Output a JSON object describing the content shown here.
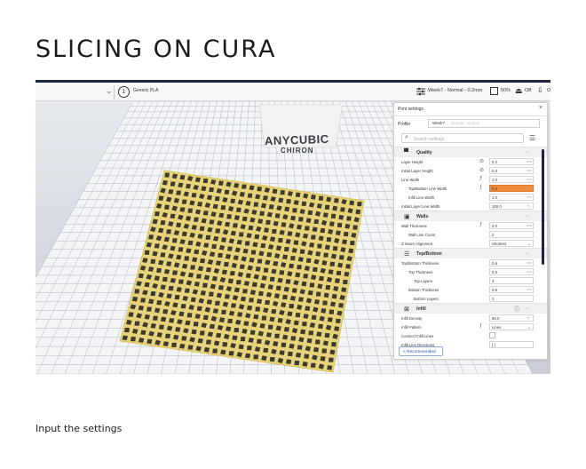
{
  "slide": {
    "title": "SLICING ON CURA",
    "caption": "Input the settings"
  },
  "toolbar": {
    "material_badge": "1",
    "material": "Generic PLA",
    "profile": "Week7 - Normal - 0.2mm",
    "support_value": "50%",
    "adhesion_value": "Off",
    "extra_value": "Of"
  },
  "viewport": {
    "printer_brand": "ANYCUBIC",
    "printer_model": "CHIRON"
  },
  "panel": {
    "title": "Print settings",
    "close_icon": "×",
    "profile_label": "Profile",
    "profile_value": "Week7",
    "profile_hint": "Normal - 0.2mm",
    "search_placeholder": "Search settings",
    "recommended_label": "< Recommended",
    "categories": {
      "quality": "Quality",
      "walls": "Walls",
      "top_bottom": "Top/Bottom",
      "infill": "Infill"
    },
    "settings": {
      "layer_height": {
        "label": "Layer Height",
        "value": "0.2",
        "unit": "mm"
      },
      "initial_layer_height": {
        "label": "Initial Layer Height",
        "value": "0.3",
        "unit": "mm"
      },
      "line_width": {
        "label": "Line Width",
        "value": "1.0",
        "unit": "mm"
      },
      "top_bottom_line_width": {
        "label": "Top/Bottom Line Width",
        "value": "0.4",
        "unit": "mm"
      },
      "infill_line_width": {
        "label": "Infill Line Width",
        "value": "1.0",
        "unit": "mm"
      },
      "initial_layer_line_width": {
        "label": "Initial Layer Line Width",
        "value": "100.0",
        "unit": "%"
      },
      "wall_thickness": {
        "label": "Wall Thickness",
        "value": "2.0",
        "unit": "mm"
      },
      "wall_line_count": {
        "label": "Wall Line Count",
        "value": "2",
        "unit": ""
      },
      "z_seam_alignment": {
        "label": "Z Seam Alignment",
        "value": "Shortest",
        "unit": ""
      },
      "top_bottom_thickness": {
        "label": "Top/Bottom Thickness",
        "value": "0.6",
        "unit": "mm"
      },
      "top_thickness": {
        "label": "Top Thickness",
        "value": "0.6",
        "unit": "mm"
      },
      "top_layers": {
        "label": "Top Layers",
        "value": "3",
        "unit": ""
      },
      "bottom_thickness": {
        "label": "Bottom Thickness",
        "value": "0.6",
        "unit": "mm"
      },
      "bottom_layers": {
        "label": "Bottom Layers",
        "value": "3",
        "unit": ""
      },
      "infill_density": {
        "label": "Infill Density",
        "value": "50.0",
        "unit": "%"
      },
      "infill_pattern": {
        "label": "Infill Pattern",
        "value": "Lines",
        "unit": ""
      },
      "connect_infill_lines": {
        "label": "Connect Infill Lines",
        "value": "",
        "unit": ""
      },
      "infill_line_directions": {
        "label": "Infill Line Directions",
        "value": "[ ]",
        "unit": ""
      }
    }
  },
  "colors": {
    "accent": "#1f2540",
    "highlight_field": "#f08a3c",
    "model_fill": "#e7d37a",
    "model_cell": "#3d3a30"
  }
}
